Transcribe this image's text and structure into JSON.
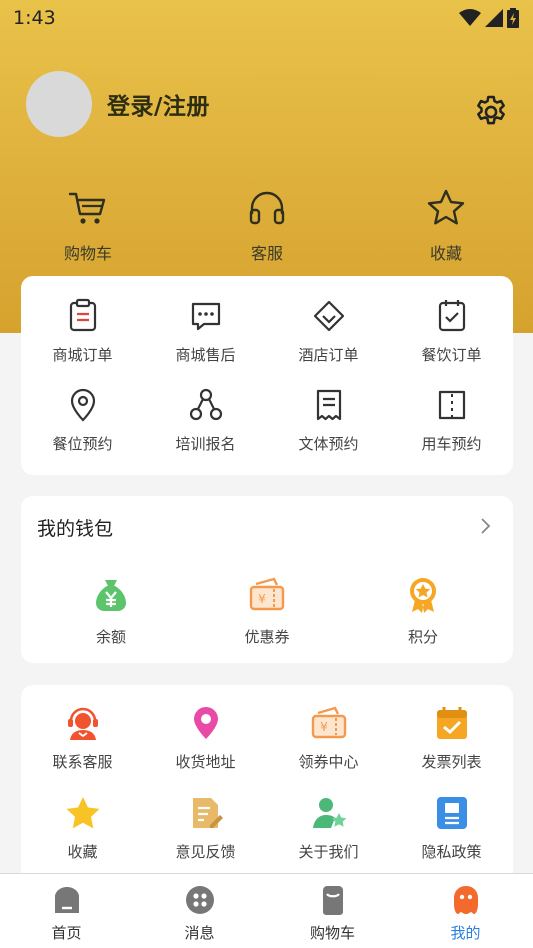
{
  "status_bar": {
    "time": "1:43"
  },
  "profile": {
    "login_label": "登录/注册"
  },
  "quick_actions": [
    {
      "label": "购物车",
      "icon": "cart-icon"
    },
    {
      "label": "客服",
      "icon": "headphones-icon"
    },
    {
      "label": "收藏",
      "icon": "star-outline-icon"
    }
  ],
  "orders": [
    {
      "label": "商城订单",
      "icon": "clipboard-icon"
    },
    {
      "label": "商城售后",
      "icon": "chat-dots-icon"
    },
    {
      "label": "酒店订单",
      "icon": "diamond-icon"
    },
    {
      "label": "餐饮订单",
      "icon": "calendar-check-icon"
    },
    {
      "label": "餐位预约",
      "icon": "location-pin-icon"
    },
    {
      "label": "培训报名",
      "icon": "network-icon"
    },
    {
      "label": "文体预约",
      "icon": "receipt-icon"
    },
    {
      "label": "用车预约",
      "icon": "ticket-icon"
    }
  ],
  "wallet": {
    "title": "我的钱包",
    "items": [
      {
        "label": "余额",
        "icon": "money-bag-icon",
        "color": "#5cc46a"
      },
      {
        "label": "优惠券",
        "icon": "coupon-icon",
        "color": "#f59a4d"
      },
      {
        "label": "积分",
        "icon": "medal-icon",
        "color": "#f5a623"
      }
    ]
  },
  "services": [
    {
      "label": "联系客服",
      "icon": "support-agent-icon",
      "color": "#f0532e"
    },
    {
      "label": "收货地址",
      "icon": "map-pin-icon",
      "color": "#e94aa6"
    },
    {
      "label": "领券中心",
      "icon": "coupon-center-icon",
      "color": "#f59a4d"
    },
    {
      "label": "发票列表",
      "icon": "invoice-calendar-icon",
      "color": "#f5a623"
    },
    {
      "label": "收藏",
      "icon": "star-filled-icon",
      "color": "#f7c325"
    },
    {
      "label": "意见反馈",
      "icon": "feedback-icon",
      "color": "#e8b969"
    },
    {
      "label": "关于我们",
      "icon": "about-user-icon",
      "color": "#4cb878"
    },
    {
      "label": "隐私政策",
      "icon": "privacy-doc-icon",
      "color": "#3a8ee6"
    }
  ],
  "tabbar": [
    {
      "label": "首页",
      "icon": "home-icon"
    },
    {
      "label": "消息",
      "icon": "message-icon"
    },
    {
      "label": "购物车",
      "icon": "cart-tab-icon"
    },
    {
      "label": "我的",
      "icon": "profile-icon",
      "active": true
    }
  ],
  "colors": {
    "accent": "#2b7fe0",
    "header": "#deb03b",
    "icon_dark": "#333333"
  }
}
